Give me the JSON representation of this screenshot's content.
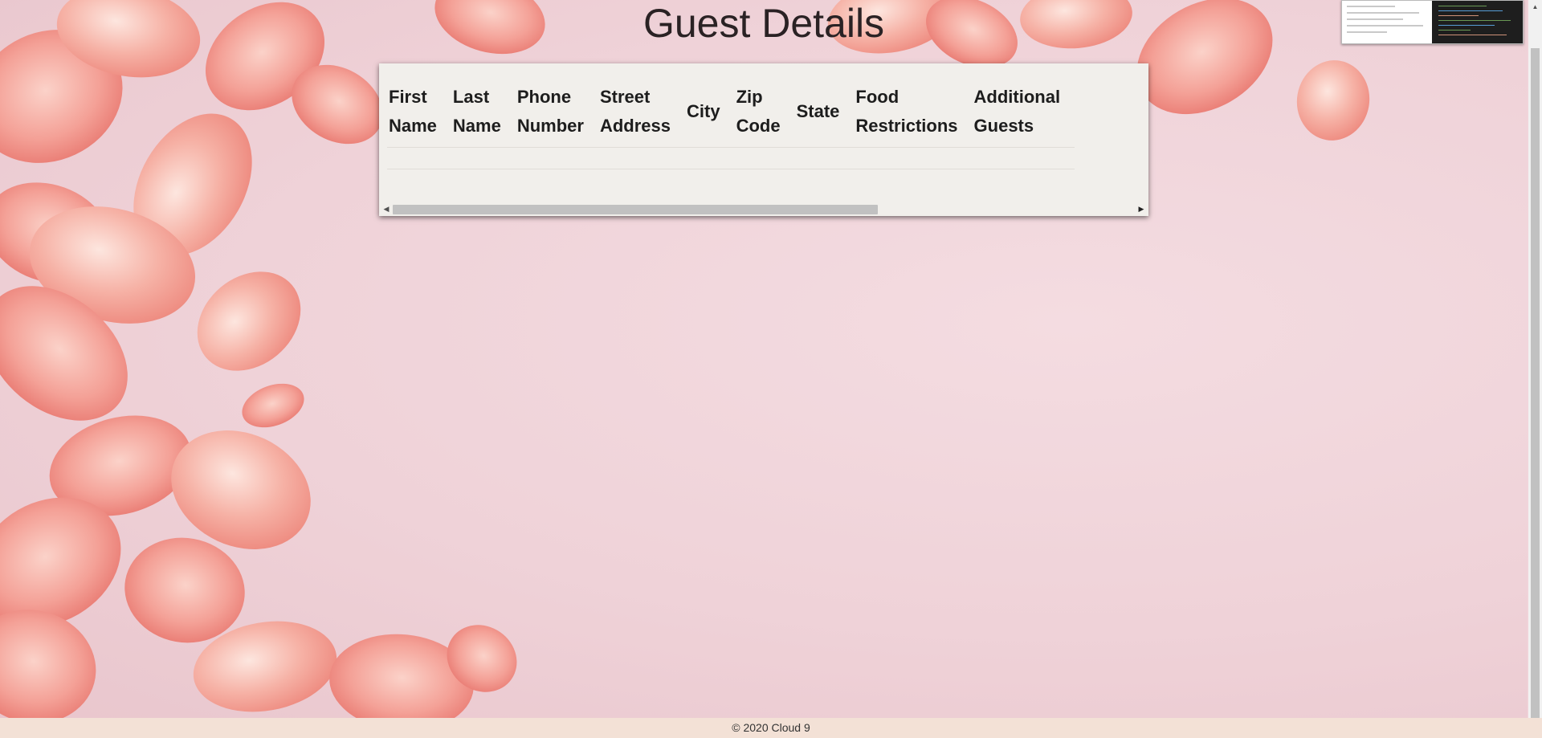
{
  "page": {
    "title": "Guest Details"
  },
  "table": {
    "columns": [
      {
        "line1": "First",
        "line2": "Name"
      },
      {
        "line1": "Last",
        "line2": "Name"
      },
      {
        "line1": "Phone",
        "line2": "Number"
      },
      {
        "line1": "Street",
        "line2": "Address"
      },
      {
        "line1": "City",
        "line2": ""
      },
      {
        "line1": "Zip",
        "line2": "Code"
      },
      {
        "line1": "State",
        "line2": ""
      },
      {
        "line1": "Food",
        "line2": "Restrictions"
      },
      {
        "line1": "Additional",
        "line2": "Guests"
      }
    ],
    "rows": []
  },
  "footer": {
    "text": "© 2020 Cloud 9"
  },
  "icons": {
    "scroll_left": "scroll-left-arrow-icon",
    "scroll_right": "scroll-right-arrow-icon",
    "scroll_up": "scroll-up-arrow-icon"
  },
  "colors": {
    "background": "#efd2d8",
    "petal": "#f29a93",
    "card": "#f1efeb",
    "footer": "#f3e1d6"
  }
}
